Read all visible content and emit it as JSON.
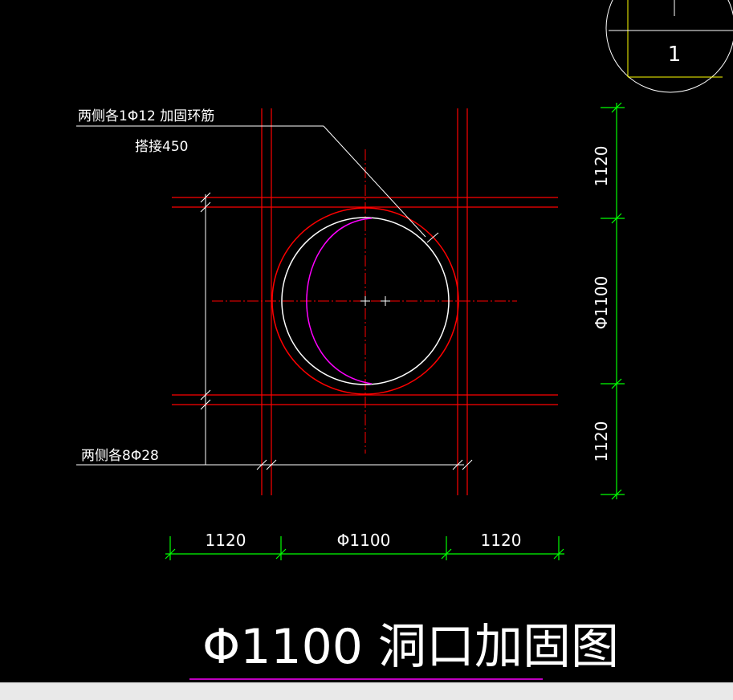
{
  "drawing": {
    "title": "Φ1100 洞口加固图",
    "labels": {
      "ring_bar_line1": "两侧各1Φ12 加固环筋",
      "ring_bar_line2": "搭接450",
      "side_bars": "两侧各8Φ28"
    },
    "dims_bottom": [
      "1120",
      "Φ1100",
      "1120"
    ],
    "dims_right": [
      "1120",
      "Φ1100",
      "1120"
    ],
    "section_mark": "1"
  },
  "colors": {
    "background": "#000000",
    "rebar": "#ff0000",
    "outline": "#ffffff",
    "dimension": "#00ff00",
    "arc": "#ff00ff",
    "viewport": "#ffff00",
    "statusbar": "#e9e9e9"
  }
}
